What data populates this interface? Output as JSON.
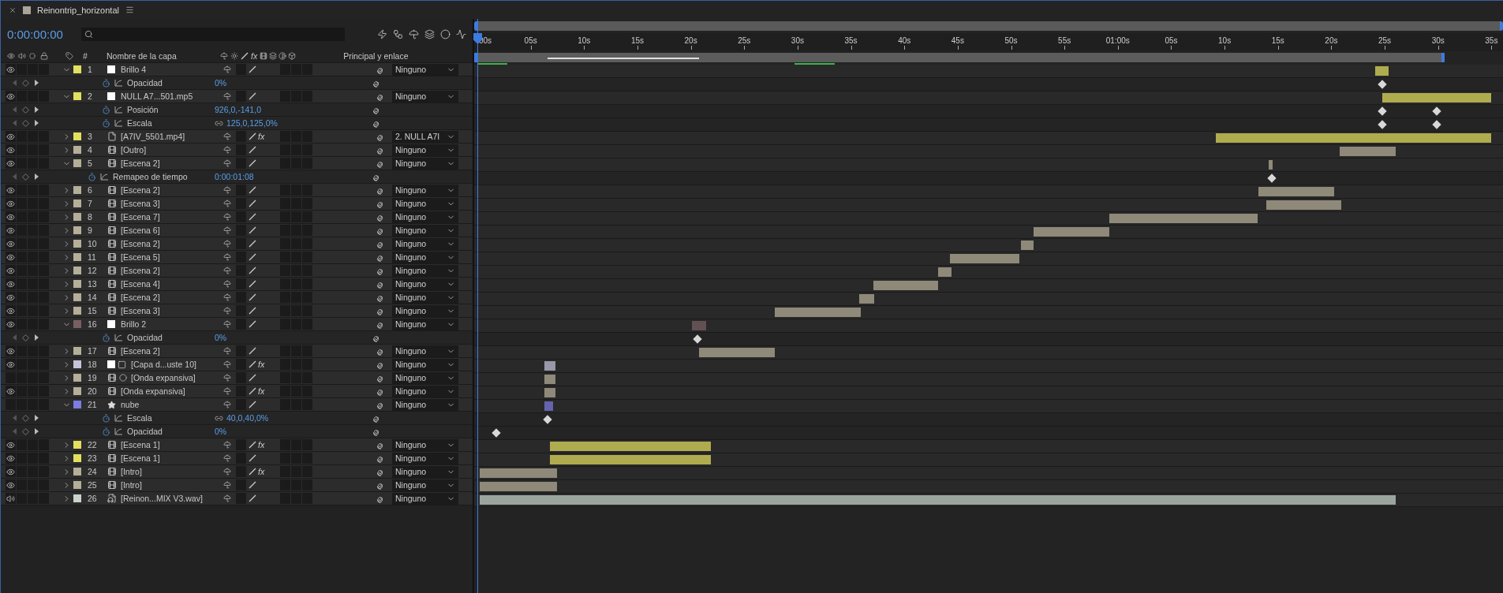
{
  "tab": {
    "title": "Reinontrip_horizontal"
  },
  "timecode": "0:00:00:00",
  "columns": {
    "number": "#",
    "name": "Nombre de la capa",
    "fx": "fx",
    "parent": "Principal y enlace"
  },
  "ruler": [
    "00s",
    "05s",
    "10s",
    "15s",
    "20s",
    "25s",
    "30s",
    "35s",
    "40s",
    "45s",
    "50s",
    "55s",
    "01:00s",
    "05s",
    "10s",
    "15s",
    "20s",
    "25s",
    "30s",
    "35s"
  ],
  "rows": [
    {
      "kind": "layer",
      "number": "1",
      "name": "Brillo 4",
      "color": "#e3df5f",
      "source": {
        "kind": "solid"
      },
      "visible": true,
      "expanded": true,
      "parent": "Ninguno"
    },
    {
      "kind": "property",
      "name": "Opacidad",
      "value": "0%",
      "linked": false
    },
    {
      "kind": "layer",
      "number": "2",
      "name": "NULL A7...501.mp5",
      "color": "#e3df5f",
      "source": {
        "kind": "solid"
      },
      "visible": true,
      "expanded": true,
      "parent": "Ninguno"
    },
    {
      "kind": "property",
      "name": "Posición",
      "value": "926,0,-141,0",
      "linked": false
    },
    {
      "kind": "property",
      "name": "Escala",
      "value": "125,0,125,0%",
      "linked": true
    },
    {
      "kind": "layer",
      "number": "3",
      "name": "[A7IV_5501.mp4]",
      "color": "#e3df5f",
      "source": {
        "kind": "footage"
      },
      "visible": true,
      "expanded": false,
      "fx": "fx",
      "fx_on": true,
      "parent": "2. NULL A7I"
    },
    {
      "kind": "layer",
      "number": "4",
      "name": "[Outro]",
      "color": "#b5ae98",
      "source": {
        "kind": "comp"
      },
      "visible": true,
      "expanded": false,
      "parent": "Ninguno"
    },
    {
      "kind": "layer",
      "number": "5",
      "name": "[Escena 2]",
      "color": "#b5ae98",
      "source": {
        "kind": "comp"
      },
      "visible": true,
      "expanded": true,
      "parent": "Ninguno"
    },
    {
      "kind": "remap",
      "name": "Remapeo de tiempo",
      "value": "0:00:01:08",
      "linked": false
    },
    {
      "kind": "layer",
      "number": "6",
      "name": "[Escena 2]",
      "color": "#b5ae98",
      "source": {
        "kind": "comp"
      },
      "visible": true,
      "expanded": false,
      "parent": "Ninguno"
    },
    {
      "kind": "layer",
      "number": "7",
      "name": "[Escena 3]",
      "color": "#b5ae98",
      "source": {
        "kind": "comp"
      },
      "visible": true,
      "expanded": false,
      "parent": "Ninguno"
    },
    {
      "kind": "layer",
      "number": "8",
      "name": "[Escena 7]",
      "color": "#b5ae98",
      "source": {
        "kind": "comp"
      },
      "visible": true,
      "expanded": false,
      "parent": "Ninguno"
    },
    {
      "kind": "layer",
      "number": "9",
      "name": "[Escena 6]",
      "color": "#b5ae98",
      "source": {
        "kind": "comp"
      },
      "visible": true,
      "expanded": false,
      "parent": "Ninguno"
    },
    {
      "kind": "layer",
      "number": "10",
      "name": "[Escena 2]",
      "color": "#b5ae98",
      "source": {
        "kind": "comp"
      },
      "visible": true,
      "expanded": false,
      "parent": "Ninguno"
    },
    {
      "kind": "layer",
      "number": "11",
      "name": "[Escena 5]",
      "color": "#b5ae98",
      "source": {
        "kind": "comp"
      },
      "visible": true,
      "expanded": false,
      "parent": "Ninguno"
    },
    {
      "kind": "layer",
      "number": "12",
      "name": "[Escena 2]",
      "color": "#b5ae98",
      "source": {
        "kind": "comp"
      },
      "visible": true,
      "expanded": false,
      "parent": "Ninguno"
    },
    {
      "kind": "layer",
      "number": "13",
      "name": "[Escena 4]",
      "color": "#b5ae98",
      "source": {
        "kind": "comp"
      },
      "visible": true,
      "expanded": false,
      "parent": "Ninguno"
    },
    {
      "kind": "layer",
      "number": "14",
      "name": "[Escena 2]",
      "color": "#b5ae98",
      "source": {
        "kind": "comp"
      },
      "visible": true,
      "expanded": false,
      "parent": "Ninguno"
    },
    {
      "kind": "layer",
      "number": "15",
      "name": "[Escena 3]",
      "color": "#b5ae98",
      "source": {
        "kind": "comp"
      },
      "visible": true,
      "expanded": false,
      "parent": "Ninguno"
    },
    {
      "kind": "layer",
      "number": "16",
      "name": "Brillo 2",
      "color": "#7a5f62",
      "source": {
        "kind": "solid"
      },
      "visible": true,
      "expanded": true,
      "parent": "Ninguno"
    },
    {
      "kind": "property",
      "name": "Opacidad",
      "value": "0%",
      "linked": false
    },
    {
      "kind": "layer",
      "number": "17",
      "name": "[Escena 2]",
      "color": "#b5ae98",
      "source": {
        "kind": "comp"
      },
      "visible": true,
      "expanded": false,
      "parent": "Ninguno"
    },
    {
      "kind": "layer",
      "number": "18",
      "name": "[Capa d...uste 10]",
      "color": "#c4c4dc",
      "source": {
        "kind": "adjustment"
      },
      "visible": true,
      "expanded": false,
      "fx": "fx",
      "fx_on": true,
      "parent": "Ninguno"
    },
    {
      "kind": "layer",
      "number": "19",
      "name": "[Onda expansiva]",
      "color": "#b5ae98",
      "source": {
        "kind": "matte"
      },
      "visible": false,
      "expanded": false,
      "parent": "Ninguno"
    },
    {
      "kind": "layer",
      "number": "20",
      "name": "[Onda expansiva]",
      "color": "#b5ae98",
      "source": {
        "kind": "comp"
      },
      "visible": true,
      "expanded": false,
      "fx": "fx",
      "fx_on": true,
      "parent": "Ninguno"
    },
    {
      "kind": "layer",
      "number": "21",
      "name": "nube",
      "color": "#7c7ce2",
      "source": {
        "kind": "shape"
      },
      "visible": false,
      "expanded": true,
      "parent": "Ninguno"
    },
    {
      "kind": "property",
      "name": "Escala",
      "value": "40,0,40,0%",
      "linked": true
    },
    {
      "kind": "property",
      "name": "Opacidad",
      "value": "0%",
      "linked": false
    },
    {
      "kind": "layer",
      "number": "22",
      "name": "[Escena 1]",
      "color": "#e3df5f",
      "source": {
        "kind": "comp"
      },
      "visible": true,
      "expanded": false,
      "fx": "fx",
      "fx_on": true,
      "parent": "Ninguno"
    },
    {
      "kind": "layer",
      "number": "23",
      "name": "[Escena 1]",
      "color": "#e3df5f",
      "source": {
        "kind": "comp"
      },
      "visible": true,
      "expanded": false,
      "parent": "Ninguno"
    },
    {
      "kind": "layer",
      "number": "24",
      "name": "[Intro]",
      "color": "#b5ae98",
      "source": {
        "kind": "comp"
      },
      "visible": true,
      "expanded": false,
      "fx": "fx",
      "fx_on": true,
      "parent": "Ninguno"
    },
    {
      "kind": "layer",
      "number": "25",
      "name": "[Intro]",
      "color": "#b5ae98",
      "source": {
        "kind": "comp"
      },
      "visible": true,
      "expanded": false,
      "parent": "Ninguno"
    },
    {
      "kind": "layer",
      "number": "26",
      "name": "[Reinon...MIX V3.wav]",
      "color": "#c9d4cc",
      "source": {
        "kind": "audio"
      },
      "visible": true,
      "expanded": false,
      "parent": "Ninguno"
    }
  ]
}
